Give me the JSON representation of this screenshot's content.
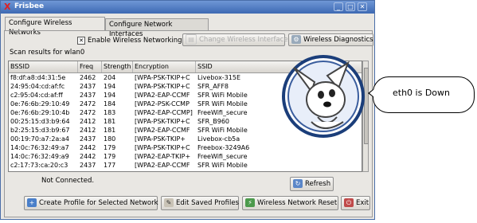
{
  "window": {
    "title": "Frisbee",
    "app_icon": "X"
  },
  "tabs": [
    {
      "label": "Configure Wireless Networks",
      "active": true
    },
    {
      "label": "Configure Network Interfaces",
      "active": false
    }
  ],
  "toolbar": {
    "enable_wireless_checked": true,
    "enable_wireless_label": "Enable Wireless Networking",
    "change_interface_label": "Change Wireless Interface",
    "diagnostics_label": "Wireless Diagnostics"
  },
  "scan": {
    "label": "Scan results for wlan0",
    "columns": [
      "BSSID",
      "Freq",
      "Strength",
      "Encryption",
      "SSID"
    ],
    "rows": [
      [
        "f8:df:a8:d4:31:5e",
        "2462",
        "204",
        "[WPA-PSK-TKIP+C",
        "Livebox-315E"
      ],
      [
        "24:95:04:cd:af:fc",
        "2437",
        "194",
        "[WPA-PSK-TKIP+C",
        "SFR_AFF8"
      ],
      [
        "c2:95:04:cd:af:ff",
        "2437",
        "194",
        "[WPA2-EAP-CCMF",
        "SFR WiFi Mobile"
      ],
      [
        "0e:76:6b:29:10:49",
        "2472",
        "184",
        "[WPA2-PSK-CCMP",
        "SFR WiFi Mobile"
      ],
      [
        "0e:76:6b:29:10:4b",
        "2472",
        "183",
        "[WPA2-EAP-CCMP]",
        "FreeWifi_secure"
      ],
      [
        "00:25:15:d3:b9:64",
        "2412",
        "181",
        "[WPA-PSK-TKIP+C",
        "SFR_B960"
      ],
      [
        "b2:25:15:d3:b9:67",
        "2412",
        "181",
        "[WPA2-EAP-CCMF",
        "SFR WiFi Mobile"
      ],
      [
        "00:19:70:a7:2a:a4",
        "2437",
        "180",
        "[WPA-PSK-TKIP+",
        "Livebox-cb5a"
      ],
      [
        "14:0c:76:32:49:a7",
        "2442",
        "179",
        "[WPA-PSK-TKIP+C",
        "Freebox-3249A6"
      ],
      [
        "14:0c:76:32:49:a9",
        "2442",
        "179",
        "[WPA2-EAP-TKIP+",
        "FreeWifi_secure"
      ],
      [
        "c2:17:73:ca:20:c3",
        "2437",
        "177",
        "[WPA2-EAP-CCMF",
        "SFR WiFi Mobile"
      ]
    ]
  },
  "status": {
    "text": "Not Connected."
  },
  "buttons": {
    "refresh": "Refresh",
    "create_profile": "Create Profile for Selected Network",
    "edit_profiles": "Edit Saved Profiles",
    "reset": "Wireless Network Reset",
    "exit": "Exit"
  },
  "bubble": {
    "text": "eth0 is Down"
  },
  "icons": {
    "app": "x-icon",
    "diagnostics": "gear-icon",
    "refresh": "refresh-icon",
    "create": "plus-icon",
    "edit": "edit-icon",
    "reset": "network-icon",
    "exit": "exit-icon"
  }
}
